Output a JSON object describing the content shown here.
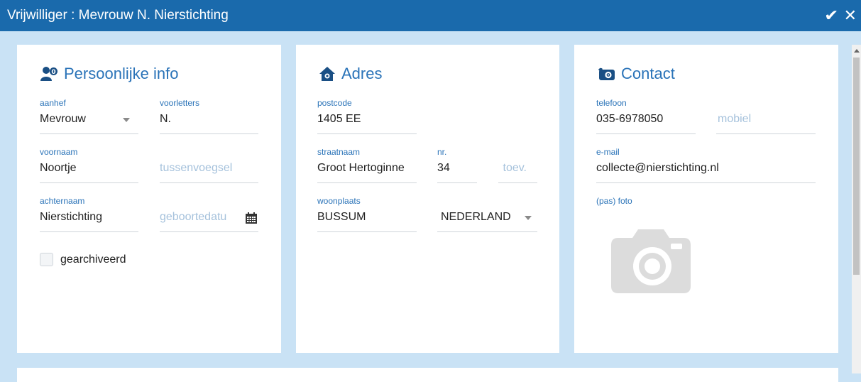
{
  "window": {
    "title": "Vrijwilliger : Mevrouw N. Nierstichting"
  },
  "personal": {
    "title": "Persoonlijke info",
    "aanhef": {
      "label": "aanhef",
      "value": "Mevrouw"
    },
    "voorletters": {
      "label": "voorletters",
      "value": "N."
    },
    "voornaam": {
      "label": "voornaam",
      "value": "Noortje"
    },
    "tussenvoegsel": {
      "placeholder": "tussenvoegsel"
    },
    "achternaam": {
      "label": "achternaam",
      "value": "Nierstichting"
    },
    "geboortedatum": {
      "placeholder": "geboortedatu"
    },
    "archived": {
      "label": "gearchiveerd",
      "checked": false
    }
  },
  "address": {
    "title": "Adres",
    "postcode": {
      "label": "postcode",
      "value": "1405 EE"
    },
    "straatnaam": {
      "label": "straatnaam",
      "value": "Groot Hertoginne"
    },
    "nr": {
      "label": "nr.",
      "value": "34"
    },
    "toev": {
      "placeholder": "toev."
    },
    "woonplaats": {
      "label": "woonplaats",
      "value": "BUSSUM"
    },
    "land": {
      "value": "NEDERLAND"
    }
  },
  "contact": {
    "title": "Contact",
    "telefoon": {
      "label": "telefoon",
      "value": "035-6978050"
    },
    "mobiel": {
      "placeholder": "mobiel"
    },
    "email": {
      "label": "e-mail",
      "value": "collecte@nierstichting.nl"
    },
    "foto": {
      "label": "(pas) foto"
    }
  },
  "icons": {
    "confirm": "check-icon",
    "close": "close-icon",
    "personal": "person-info-icon",
    "address": "home-icon",
    "contact": "contact-card-icon",
    "calendar": "calendar-icon",
    "photo": "camera-icon"
  },
  "colors": {
    "titlebar": "#1a6aac",
    "accent": "#2a73b8",
    "placeholder": "#a6c2dc",
    "background": "#c9e2f5"
  }
}
